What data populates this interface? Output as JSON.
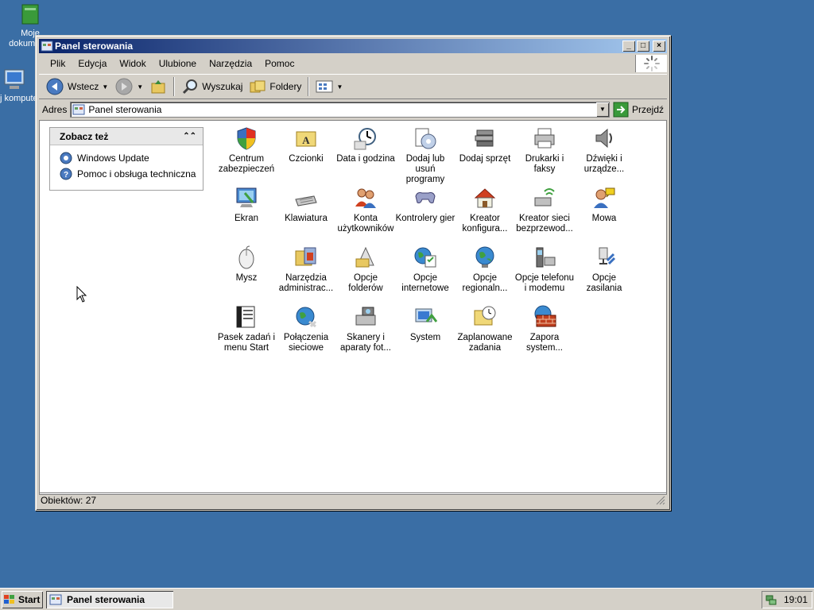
{
  "desktop": {
    "icons": [
      {
        "label": "Moje dokumenty",
        "icon": "my-documents-icon"
      },
      {
        "label": "Mój komputer",
        "icon": "my-computer-icon"
      }
    ]
  },
  "window": {
    "title": "Panel sterowania",
    "controls": {
      "minimize": "_",
      "maximize": "□",
      "close": "×"
    }
  },
  "menu": [
    "Plik",
    "Edycja",
    "Widok",
    "Ulubione",
    "Narzędzia",
    "Pomoc"
  ],
  "toolbar": {
    "back": "Wstecz",
    "search": "Wyszukaj",
    "folders": "Foldery"
  },
  "address": {
    "label": "Adres",
    "value": "Panel sterowania",
    "go": "Przejdź"
  },
  "taskpane": {
    "title": "Zobacz też",
    "links": [
      "Windows Update",
      "Pomoc i obsługa techniczna"
    ]
  },
  "items": [
    {
      "l1": "Centrum",
      "l2": "zabezpieczeń",
      "icon": "security-center-icon"
    },
    {
      "l1": "Czcionki",
      "l2": "",
      "icon": "fonts-icon"
    },
    {
      "l1": "Data i godzina",
      "l2": "",
      "icon": "date-time-icon"
    },
    {
      "l1": "Dodaj lub usuń",
      "l2": "programy",
      "icon": "add-remove-programs-icon"
    },
    {
      "l1": "Dodaj sprzęt",
      "l2": "",
      "icon": "add-hardware-icon"
    },
    {
      "l1": "Drukarki i",
      "l2": "faksy",
      "icon": "printers-faxes-icon"
    },
    {
      "l1": "Dźwięki i",
      "l2": "urządze...",
      "icon": "sounds-icon"
    },
    {
      "l1": "Ekran",
      "l2": "",
      "icon": "display-icon"
    },
    {
      "l1": "Klawiatura",
      "l2": "",
      "icon": "keyboard-icon"
    },
    {
      "l1": "Konta",
      "l2": "użytkowników",
      "icon": "user-accounts-icon"
    },
    {
      "l1": "Kontrolery gier",
      "l2": "",
      "icon": "game-controllers-icon"
    },
    {
      "l1": "Kreator",
      "l2": "konfigura...",
      "icon": "network-setup-icon"
    },
    {
      "l1": "Kreator sieci",
      "l2": "bezprzewod...",
      "icon": "wireless-network-icon"
    },
    {
      "l1": "Mowa",
      "l2": "",
      "icon": "speech-icon"
    },
    {
      "l1": "Mysz",
      "l2": "",
      "icon": "mouse-icon"
    },
    {
      "l1": "Narzędzia",
      "l2": "administrac...",
      "icon": "admin-tools-icon"
    },
    {
      "l1": "Opcje folderów",
      "l2": "",
      "icon": "folder-options-icon"
    },
    {
      "l1": "Opcje",
      "l2": "internetowe",
      "icon": "internet-options-icon"
    },
    {
      "l1": "Opcje",
      "l2": "regionaln...",
      "icon": "regional-options-icon"
    },
    {
      "l1": "Opcje telefonu",
      "l2": "i modemu",
      "icon": "phone-modem-icon"
    },
    {
      "l1": "Opcje zasilania",
      "l2": "",
      "icon": "power-options-icon"
    },
    {
      "l1": "Pasek zadań i",
      "l2": "menu Start",
      "icon": "taskbar-icon"
    },
    {
      "l1": "Połączenia",
      "l2": "sieciowe",
      "icon": "network-connections-icon"
    },
    {
      "l1": "Skanery i",
      "l2": "aparaty fot...",
      "icon": "scanners-cameras-icon"
    },
    {
      "l1": "System",
      "l2": "",
      "icon": "system-icon"
    },
    {
      "l1": "Zaplanowane",
      "l2": "zadania",
      "icon": "scheduled-tasks-icon"
    },
    {
      "l1": "Zapora",
      "l2": "system...",
      "icon": "firewall-icon"
    }
  ],
  "status": "Obiektów: 27",
  "taskbar": {
    "start": "Start",
    "task": "Panel sterowania",
    "clock": "19:01"
  }
}
